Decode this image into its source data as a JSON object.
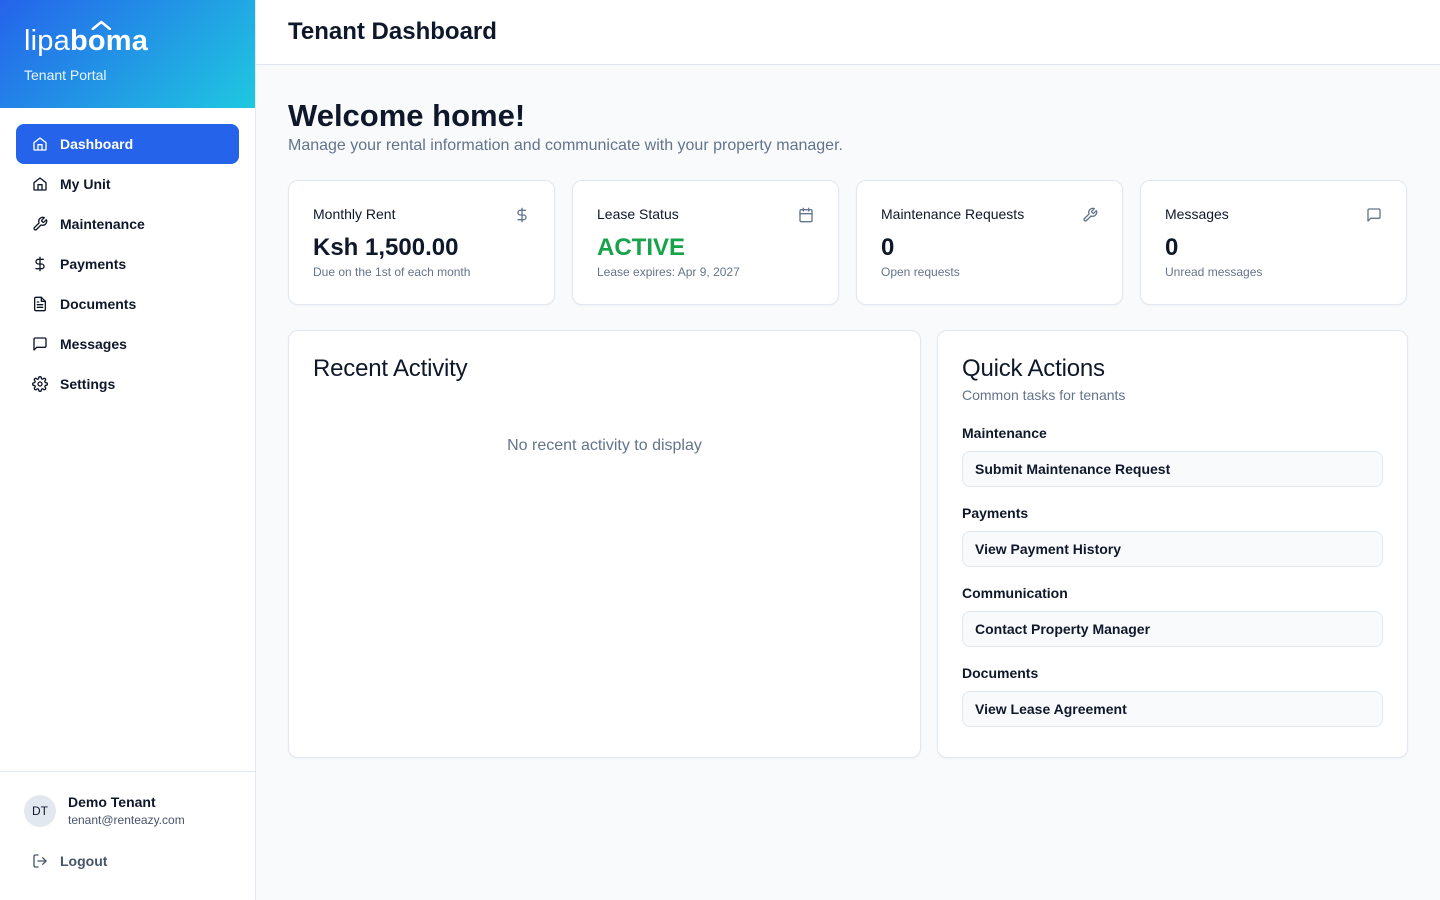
{
  "brand": {
    "logo_part1": "lipa",
    "logo_part2": "boma",
    "portal": "Tenant Portal",
    "gradient_start": "#2563eb",
    "gradient_end": "#1fc8e0"
  },
  "sidebar": {
    "items": [
      {
        "label": "Dashboard",
        "icon": "home-icon",
        "active": true
      },
      {
        "label": "My Unit",
        "icon": "home-icon",
        "active": false
      },
      {
        "label": "Maintenance",
        "icon": "wrench-icon",
        "active": false
      },
      {
        "label": "Payments",
        "icon": "dollar-icon",
        "active": false
      },
      {
        "label": "Documents",
        "icon": "file-icon",
        "active": false
      },
      {
        "label": "Messages",
        "icon": "message-icon",
        "active": false
      },
      {
        "label": "Settings",
        "icon": "gear-icon",
        "active": false
      }
    ],
    "user": {
      "initials": "DT",
      "name": "Demo Tenant",
      "email": "tenant@renteazy.com"
    },
    "logout_label": "Logout"
  },
  "header": {
    "title": "Tenant Dashboard"
  },
  "main": {
    "welcome": "Welcome home!",
    "subtitle": "Manage your rental information and communicate with your property manager.",
    "stats": [
      {
        "title": "Monthly Rent",
        "value": "Ksh 1,500.00",
        "note": "Due on the 1st of each month",
        "icon": "dollar-icon"
      },
      {
        "title": "Lease Status",
        "value": "ACTIVE",
        "note": "Lease expires: Apr 9, 2027",
        "icon": "calendar-icon",
        "value_color": "#16a34a"
      },
      {
        "title": "Maintenance Requests",
        "value": "0",
        "note": "Open requests",
        "icon": "wrench-icon"
      },
      {
        "title": "Messages",
        "value": "0",
        "note": "Unread messages",
        "icon": "message-icon"
      }
    ],
    "activity": {
      "title": "Recent Activity",
      "empty": "No recent activity to display"
    },
    "quick_actions": {
      "title": "Quick Actions",
      "subtitle": "Common tasks for tenants",
      "groups": [
        {
          "label": "Maintenance",
          "button": "Submit Maintenance Request"
        },
        {
          "label": "Payments",
          "button": "View Payment History"
        },
        {
          "label": "Communication",
          "button": "Contact Property Manager"
        },
        {
          "label": "Documents",
          "button": "View Lease Agreement"
        }
      ]
    }
  }
}
